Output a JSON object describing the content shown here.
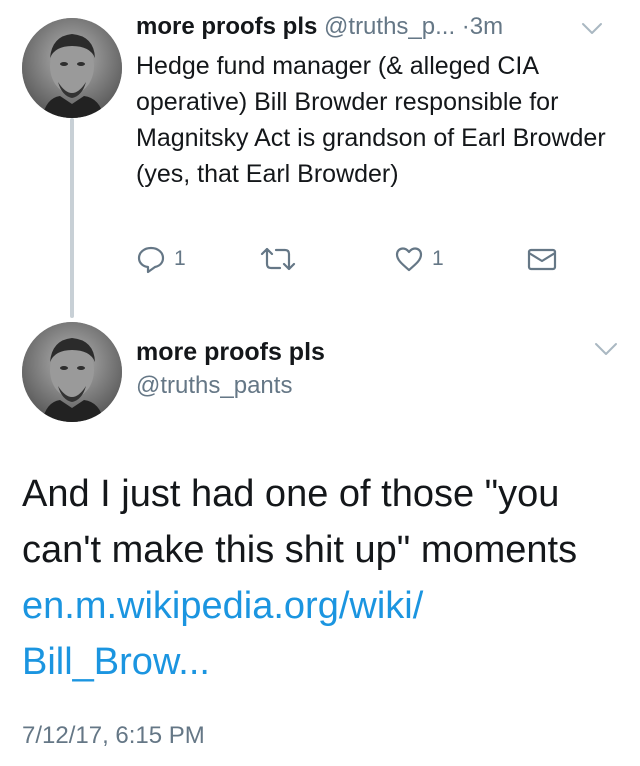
{
  "reply_tweet": {
    "display_name": "more proofs pls",
    "handle": "@truths_p...",
    "dot": "·",
    "time": "3m",
    "text": "Hedge fund manager (& alleged CIA operative) Bill Browder responsible for Magnitsky Act is grandson of Earl Browder (yes, that Earl Browder)",
    "reply_count": "1",
    "retweet_count": "",
    "like_count": "1",
    "icons": [
      "reply-icon",
      "retweet-icon",
      "like-icon",
      "direct-message-icon",
      "chevron-down-icon"
    ]
  },
  "main_tweet": {
    "display_name": "more proofs pls",
    "handle": "@truths_pants",
    "text": "And I just had one of those \"you can't make this shit up\" moments",
    "link_line1": "en.m.wikipedia.org/wiki/",
    "link_line2": "Bill_Brow...",
    "date": "7/12/17, 6:15 PM"
  },
  "colors": {
    "text": "#14171a",
    "secondary": "#657786",
    "link": "#1b95e0",
    "thread_line": "#c8d0d6"
  }
}
